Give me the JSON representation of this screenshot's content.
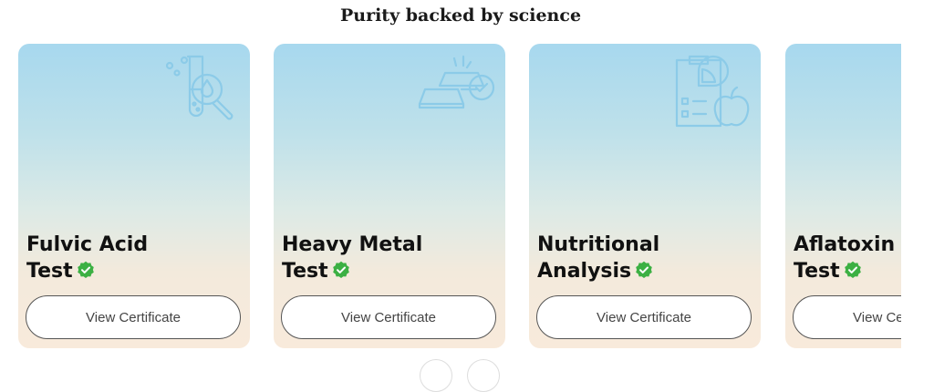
{
  "section": {
    "title": "Purity backed by science"
  },
  "cards": [
    {
      "line1": "Fulvic Acid",
      "line2": "Test",
      "button": "View Certificate",
      "icon": "test-tube-magnifier-icon"
    },
    {
      "line1": "Heavy Metal",
      "line2": "Test",
      "button": "View Certificate",
      "icon": "metal-bars-check-icon"
    },
    {
      "line1": "Nutritional",
      "line2": "Analysis",
      "button": "View Certificate",
      "icon": "nutrition-report-apple-icon"
    },
    {
      "line1": "Aflatoxin",
      "line2": "Test",
      "button": "View Certificate",
      "icon": "grain-test-icon"
    }
  ],
  "colors": {
    "verified": "#3cb043",
    "illustration": "#7ec6e6",
    "button_border": "#555555"
  }
}
